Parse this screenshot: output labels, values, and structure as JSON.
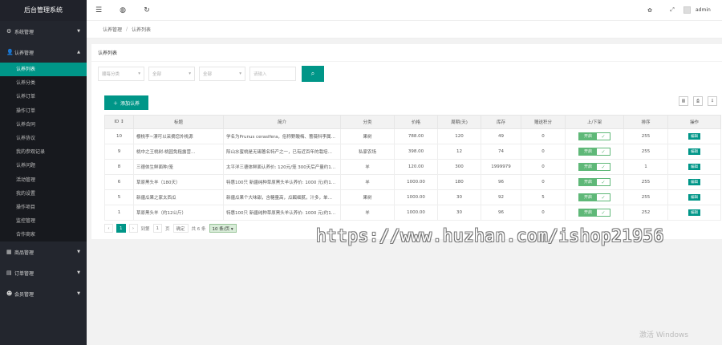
{
  "app": {
    "title": "后台管理系统"
  },
  "sidebar": {
    "groups": [
      {
        "label": "系统管理",
        "icon": "gear-icon",
        "glyph": "⚙"
      },
      {
        "label": "认养管理",
        "icon": "user-icon",
        "glyph": "👤"
      },
      {
        "label": "商品管理",
        "icon": "goods-icon",
        "glyph": "▦"
      },
      {
        "label": "订单管理",
        "icon": "order-icon",
        "glyph": "▤"
      },
      {
        "label": "会员管理",
        "icon": "member-icon",
        "glyph": "☻"
      }
    ],
    "sub_items": [
      "认养列表",
      "认养分类",
      "认养订单",
      "操作订单",
      "认养合同",
      "认养协议",
      "我的参观记录",
      "认养问题",
      "活动管理",
      "我的设置",
      "操作项目",
      "监控管理",
      "合作商家"
    ]
  },
  "topbar": {
    "icons": [
      "menu-icon",
      "globe-icon",
      "refresh-icon"
    ],
    "right_icons": [
      "theme-icon",
      "fullscreen-icon"
    ],
    "user": "admin"
  },
  "breadcrumb": {
    "root": "认养管理",
    "separator": "/",
    "current": "认养列表"
  },
  "card": {
    "title": "认养列表"
  },
  "filters": {
    "category_placeholder": "顺每分类",
    "status_placeholder": "全部",
    "type_placeholder": "全部",
    "keyword_placeholder": "请输入"
  },
  "toolbar": {
    "add_label": "添加认养"
  },
  "table": {
    "headers": [
      "ID ↕",
      "标题",
      "简介",
      "分类",
      "价格",
      "周期(天)",
      "库存",
      "赠送积分",
      "上/下架",
      "排序",
      "操作"
    ],
    "rows": [
      {
        "id": "10",
        "title": "樱桃李~漂可以采摘您外桃源",
        "intro": "学名为Prunus cerasifera，俗称野酸梅、蔷薇科李属…",
        "category": "果树",
        "price": "788.00",
        "cycle": "120",
        "stock": "49",
        "points": "0",
        "status": "开启",
        "sort": "255",
        "action": "编辑"
      },
      {
        "id": "9",
        "title": "桃中之王桃树-桃园免租露营…",
        "intro": "阳山水蜜桃是无锡著名特产之一，已有近百年的栽培…",
        "category": "私家农场",
        "price": "398.00",
        "cycle": "12",
        "stock": "74",
        "points": "0",
        "status": "开启",
        "sort": "255",
        "action": "编辑"
      },
      {
        "id": "8",
        "title": "三德体生鲜面种/笼",
        "intro": "太平洋三德体鲜面认养价: 120元/笼 300天后产量约1…",
        "category": "羊",
        "price": "120.00",
        "cycle": "300",
        "stock": "1999979",
        "points": "0",
        "status": "开启",
        "sort": "1",
        "action": "编辑"
      },
      {
        "id": "6",
        "title": "草原黑头羊（180天）",
        "intro": "特惠100只 新疆纯种草原黑头羊认养价: 1000 元(约1…",
        "category": "羊",
        "price": "1000.00",
        "cycle": "180",
        "stock": "96",
        "points": "0",
        "status": "开启",
        "sort": "255",
        "action": "编辑"
      },
      {
        "id": "5",
        "title": "新疆瓜果之家太西瓜",
        "intro": "新疆瓜果个大味甜，含糖量高，瓜瓤细腻，汁多，单…",
        "category": "果树",
        "price": "1000.00",
        "cycle": "30",
        "stock": "92",
        "points": "5",
        "status": "开启",
        "sort": "255",
        "action": "编辑"
      },
      {
        "id": "1",
        "title": "草原黑头羊（约12公斤）",
        "intro": "特惠100只 新疆纯种草原黑头羊认养价: 1000 元(约1…",
        "category": "羊",
        "price": "1000.00",
        "cycle": "30",
        "stock": "96",
        "points": "0",
        "status": "开启",
        "sort": "252",
        "action": "编辑"
      }
    ]
  },
  "pager": {
    "prev": "‹",
    "current": "1",
    "next": "›",
    "goto_label": "到第",
    "goto_value": "1",
    "page_unit": "页",
    "confirm": "确定",
    "total": "共 6 条",
    "page_size": "10 条/页 ▾"
  },
  "watermark": "https://www.huzhan.com/ishop21956",
  "os": {
    "activate": "激活 Windows"
  }
}
